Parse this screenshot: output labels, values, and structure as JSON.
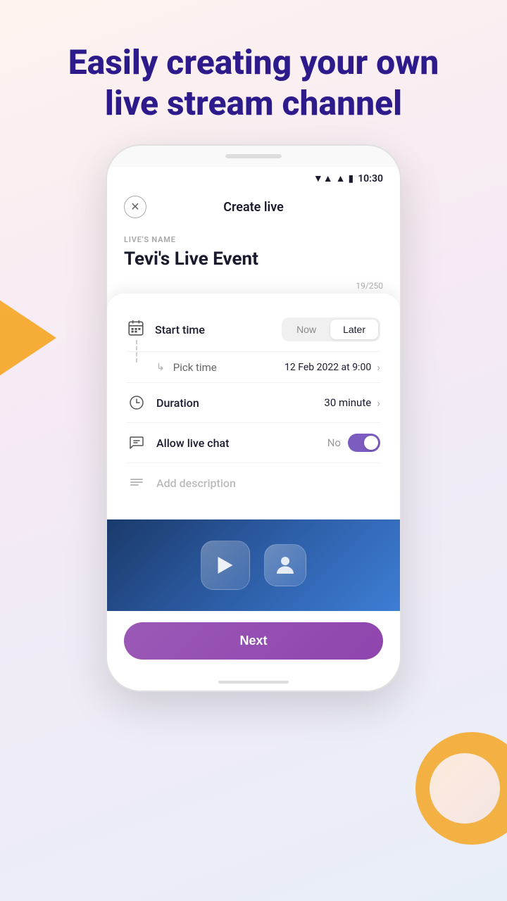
{
  "header": {
    "title": "Easily creating your own live stream channel"
  },
  "status_bar": {
    "time": "10:30",
    "wifi": "▼▲",
    "signal": "▲",
    "battery": "🔋"
  },
  "app_header": {
    "title": "Create live",
    "close_label": "×"
  },
  "live_name": {
    "label": "LIVE'S NAME",
    "value": "Tevi's Live Event",
    "char_count": "19/250"
  },
  "form": {
    "start_time": {
      "label": "Start time",
      "options": [
        "Now",
        "Later"
      ],
      "active": "Later"
    },
    "pick_time": {
      "label": "Pick time",
      "value": "12 Feb 2022 at 9:00"
    },
    "duration": {
      "label": "Duration",
      "value": "30 minute"
    },
    "allow_chat": {
      "label": "Allow live chat",
      "value": "No",
      "enabled": true
    },
    "description": {
      "placeholder": "Add description"
    }
  },
  "next_button": {
    "label": "Next"
  }
}
